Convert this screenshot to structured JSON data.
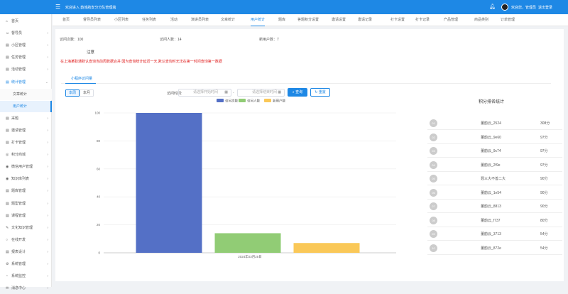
{
  "header": {
    "menu_icon": "menu-icon",
    "welcome": "欢迎进入 韵城航安分分队管理端",
    "bell_icon": "bell-icon",
    "user": "欢迎您，管理员",
    "logout": "退出登录",
    "bg_color": "#1e88e5"
  },
  "sidebar": {
    "items": [
      {
        "icon": "⌂",
        "label": "首页"
      },
      {
        "icon": "☺",
        "label": "督导员",
        "arrow": "›"
      },
      {
        "icon": "▤",
        "label": "小区管理",
        "arrow": "›"
      },
      {
        "icon": "▤",
        "label": "任务管理",
        "arrow": "›"
      },
      {
        "icon": "▤",
        "label": "活动管理",
        "arrow": "›"
      },
      {
        "icon": "▤",
        "label": "统计管理",
        "arrow": "⌄"
      }
    ],
    "subitems": [
      "文章统计",
      "用户统计"
    ],
    "items2": [
      {
        "icon": "▤",
        "label": "采题",
        "arrow": "›"
      },
      {
        "icon": "▤",
        "label": "邀请管理",
        "arrow": "›"
      },
      {
        "icon": "▤",
        "label": "打卡管理",
        "arrow": "›"
      },
      {
        "icon": "◎",
        "label": "积分商城",
        "arrow": "›"
      },
      {
        "icon": "◉",
        "label": "微信用户管理",
        "arrow": "›"
      },
      {
        "icon": "◉",
        "label": "知识库列表",
        "arrow": "›"
      },
      {
        "icon": "▤",
        "label": "题库管理",
        "arrow": "›"
      },
      {
        "icon": "▤",
        "label": "题型管理",
        "arrow": "›"
      },
      {
        "icon": "▤",
        "label": "课程管理",
        "arrow": "›"
      },
      {
        "icon": "✎",
        "label": "文化知识管理",
        "arrow": "›"
      },
      {
        "icon": "○",
        "label": "在线开发",
        "arrow": "›"
      },
      {
        "icon": "▤",
        "label": "报表设计",
        "arrow": "›"
      },
      {
        "icon": "⚙",
        "label": "系统管理",
        "arrow": "›"
      },
      {
        "icon": "◔",
        "label": "系统监控",
        "arrow": "›"
      },
      {
        "icon": "✉",
        "label": "消息中心",
        "arrow": "›"
      }
    ]
  },
  "tabs": [
    "首页",
    "督导员列表",
    "小区列表",
    "任务列表",
    "活动",
    "演讲员列表",
    "文章统计",
    "用户统计",
    "题库",
    "答题积分设置",
    "邀请设置",
    "邀请记录",
    "打卡设置",
    "打卡记录",
    "产品管理",
    "商品类别",
    "订单管理"
  ],
  "active_tab": 7,
  "stats": {
    "visits": "访问次数：100",
    "visitors": "访问人数：14",
    "new_users": "新用户数：7"
  },
  "notice": {
    "title": "注意",
    "text": "在上海某职通默认查询当前周数据合并 因为查询统计延迟一天,默认查询时无法在第一时间查询第一数据",
    "color": "#e02020"
  },
  "subtab": "小程序访问量",
  "range_buttons": [
    "本周",
    "本月"
  ],
  "filter": {
    "label": "访问时间:",
    "start_placeholder": "请选择开始时间",
    "end_placeholder": "请选择结束时间",
    "search": "查询",
    "reset": "重置",
    "search_icon": "search-icon",
    "reset_icon": "refresh-icon"
  },
  "chart_data": {
    "type": "bar",
    "categories": [
      "2024年03月25日"
    ],
    "series": [
      {
        "name": "访问次数",
        "values": [
          100
        ],
        "color": "#5470c6"
      },
      {
        "name": "访问人数",
        "values": [
          14
        ],
        "color": "#91cc75"
      },
      {
        "name": "新用户数",
        "values": [
          7
        ],
        "color": "#fac858"
      }
    ],
    "ylim": [
      0,
      100
    ],
    "yticks": [
      0,
      20,
      40,
      60,
      80,
      100
    ],
    "legend_position": "top-center",
    "grid": true
  },
  "ranking": {
    "title": "积分排名统计",
    "rows": [
      {
        "rank": "01",
        "name": "董韵云_2524",
        "score": "308分"
      },
      {
        "rank": "02",
        "name": "董韵云_9e60",
        "score": "97分"
      },
      {
        "rank": "03",
        "name": "董韵云_9c74",
        "score": "97分"
      },
      {
        "rank": "04",
        "name": "董韵云_2f9e",
        "score": "97分"
      },
      {
        "rank": "05",
        "name": "聂三大不善二大",
        "score": "90分"
      },
      {
        "rank": "06",
        "name": "董韵云_1e54",
        "score": "90分"
      },
      {
        "rank": "07",
        "name": "董韵云_8813",
        "score": "90分"
      },
      {
        "rank": "08",
        "name": "董韵云_f737",
        "score": "80分"
      },
      {
        "rank": "09",
        "name": "董韵云_3713",
        "score": "54分"
      },
      {
        "rank": "10",
        "name": "董韵云_872e",
        "score": "54分"
      }
    ]
  }
}
